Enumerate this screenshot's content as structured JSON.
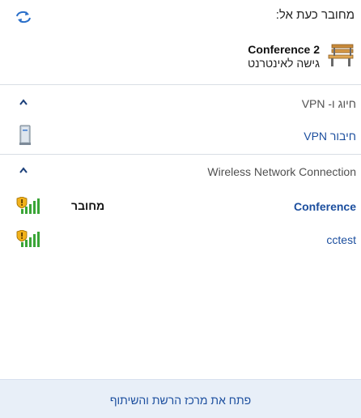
{
  "header": {
    "connected_to": "מחובר כעת אל:",
    "network_name": "Conference  2",
    "network_status": "גישה לאינטרנט",
    "refresh_icon": "refresh-arrows-icon",
    "network_icon": "park-bench-icon"
  },
  "sections": {
    "vpn": {
      "title": "חיוג ו- VPN",
      "items": [
        {
          "label": "חיבור VPN",
          "icon": "vpn-server-icon"
        }
      ]
    },
    "wireless": {
      "title": "Wireless Network Connection",
      "items": [
        {
          "label": "Conference",
          "status": "מחובר",
          "icon": "wifi-signal-shield-icon"
        },
        {
          "label": "cctest",
          "status": "",
          "icon": "wifi-signal-shield-icon"
        }
      ]
    }
  },
  "footer": {
    "open_center": "פתח את מרכז הרשת והשיתוף"
  },
  "colors": {
    "link": "#1b4e9e",
    "divider": "#d9dee5",
    "footer_bg": "#e8eff8"
  }
}
